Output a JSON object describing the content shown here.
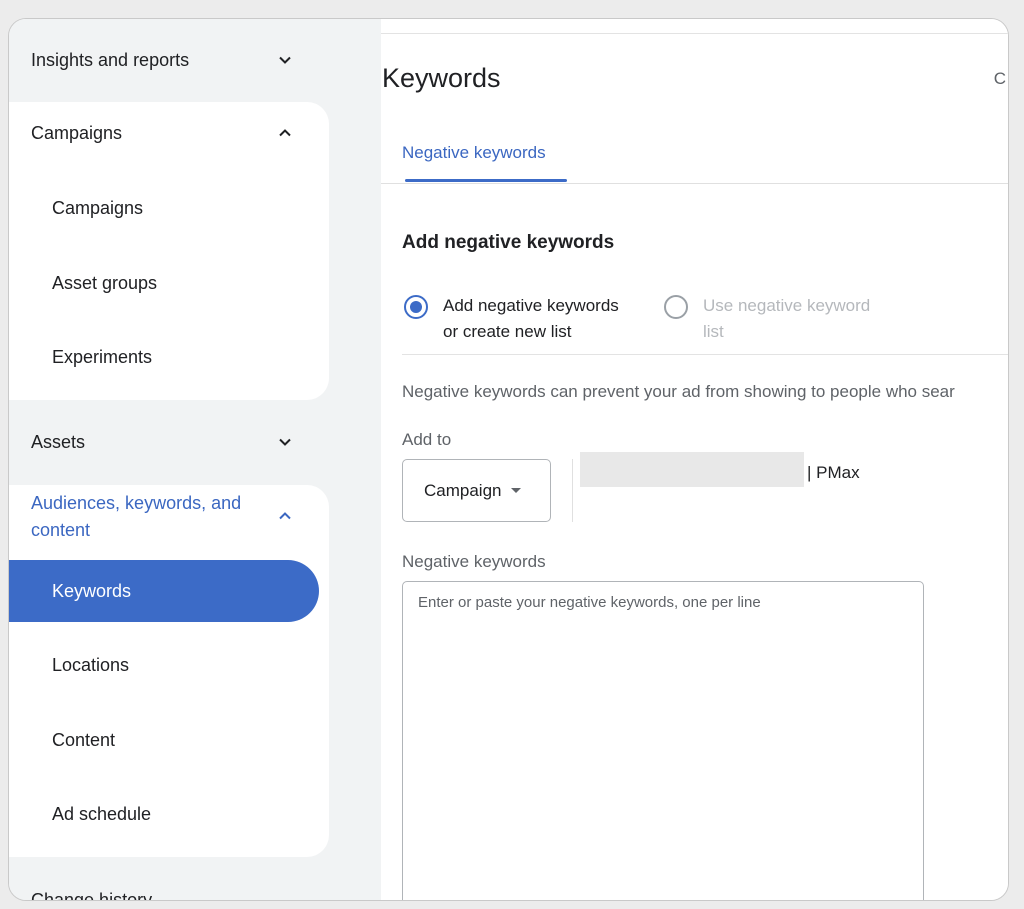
{
  "sidebar": {
    "insights": {
      "label": "Insights and reports"
    },
    "campaigns_group": {
      "label": "Campaigns",
      "items": [
        {
          "label": "Campaigns"
        },
        {
          "label": "Asset groups"
        },
        {
          "label": "Experiments"
        }
      ]
    },
    "assets": {
      "label": "Assets"
    },
    "audiences_group": {
      "label_line1": "Audiences, keywords, and",
      "label_line2": "content",
      "items": [
        {
          "label": "Keywords",
          "active": true
        },
        {
          "label": "Locations"
        },
        {
          "label": "Content"
        },
        {
          "label": "Ad schedule"
        }
      ]
    },
    "change_history": {
      "label": "Change history"
    }
  },
  "main": {
    "title": "Keywords",
    "corner_glyph": "C",
    "tab": {
      "label": "Negative keywords"
    },
    "section_title": "Add negative keywords",
    "radio_options": [
      {
        "line1": "Add negative keywords",
        "line2": "or create new list",
        "checked": true
      },
      {
        "line1": "Use negative keyword",
        "line2": "list",
        "checked": false
      }
    ],
    "help_text": "Negative keywords can prevent your ad from showing to people who sear",
    "add_to": {
      "label": "Add to",
      "dropdown_value": "Campaign",
      "campaign_suffix": "| PMax"
    },
    "negative_keywords": {
      "label": "Negative keywords",
      "placeholder": "Enter or paste your negative keywords, one per line"
    }
  },
  "colors": {
    "accent": "#3c6bc7",
    "accent_text": "#3b67c1",
    "sidebar_bg": "#f1f3f4"
  }
}
